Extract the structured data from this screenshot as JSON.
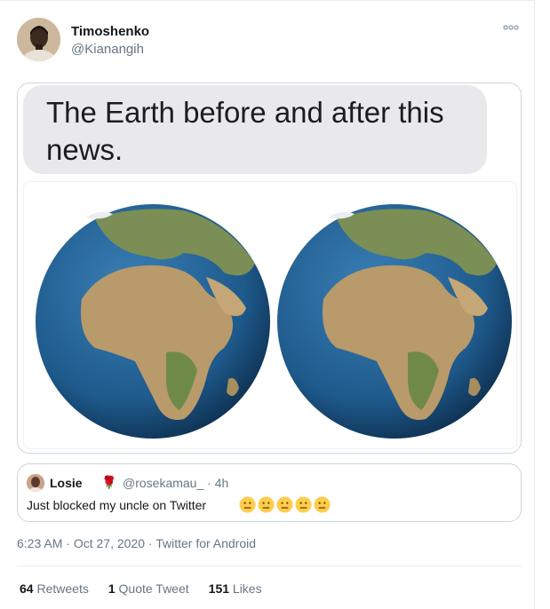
{
  "tweet": {
    "author_name": "Timoshenko",
    "author_handle": "@Kianangih",
    "media_caption": "The Earth before and after this news.",
    "more_icon": "more-options-icon"
  },
  "quoted_tweet": {
    "author_name": "Losie",
    "author_emoji": "🌹",
    "author_handle": "@rosekamau_ · 4h",
    "text": "Just blocked my uncle on Twitter",
    "emoji_name": "neutral-face-icon"
  },
  "meta": {
    "time": "6:23 AM",
    "date": "Oct 27, 2020",
    "source": "Twitter for Android"
  },
  "stats": {
    "retweets_count": "64",
    "retweets_label": "Retweets",
    "quotes_count": "1",
    "quotes_label": "Quote Tweet",
    "likes_count": "151",
    "likes_label": "Likes"
  },
  "colors": {
    "text_primary": "#14171a",
    "text_secondary": "#657786",
    "border": "#ccd6dd",
    "ocean": "#1e5a8c",
    "land": "#b99a6a"
  }
}
